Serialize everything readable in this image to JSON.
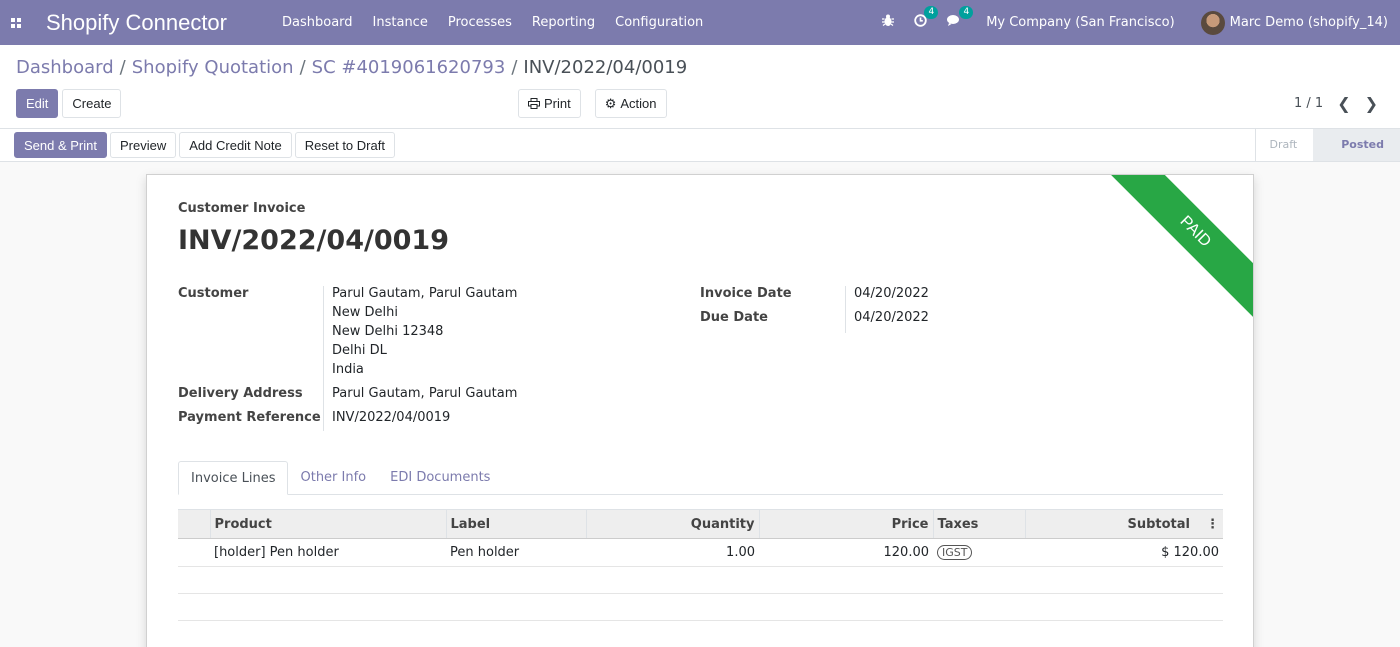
{
  "navbar": {
    "app_name": "Shopify Connector",
    "menu": [
      "Dashboard",
      "Instance",
      "Processes",
      "Reporting",
      "Configuration"
    ],
    "activity_count": "4",
    "message_count": "4",
    "company": "My Company (San Francisco)",
    "user": "Marc Demo (shopify_14)"
  },
  "breadcrumb": {
    "items": [
      "Dashboard",
      "Shopify Quotation",
      "SC #4019061620793"
    ],
    "current": "INV/2022/04/0019"
  },
  "buttons": {
    "edit": "Edit",
    "create": "Create",
    "print": "Print",
    "action": "Action"
  },
  "pager": {
    "value": "1 / 1"
  },
  "statusbar": {
    "buttons": [
      "Send & Print",
      "Preview",
      "Add Credit Note",
      "Reset to Draft"
    ],
    "stages": [
      "Draft",
      "Posted"
    ]
  },
  "invoice": {
    "ribbon": "PAID",
    "type": "Customer Invoice",
    "name": "INV/2022/04/0019",
    "customer_label": "Customer",
    "customer_name": "Parul Gautam, Parul Gautam",
    "address": [
      "New Delhi",
      "New Delhi 12348",
      "Delhi DL",
      "India"
    ],
    "delivery_label": "Delivery Address",
    "delivery_value": "Parul Gautam, Parul Gautam",
    "payment_ref_label": "Payment Reference",
    "payment_ref_value": "INV/2022/04/0019",
    "invoice_date_label": "Invoice Date",
    "invoice_date": "04/20/2022",
    "due_date_label": "Due Date",
    "due_date": "04/20/2022"
  },
  "tabs": [
    "Invoice Lines",
    "Other Info",
    "EDI Documents"
  ],
  "lines_table": {
    "headers": [
      "Product",
      "Label",
      "Quantity",
      "Price",
      "Taxes",
      "Subtotal"
    ],
    "rows": [
      {
        "product": "[holder] Pen holder",
        "label": "Pen holder",
        "quantity": "1.00",
        "price": "120.00",
        "taxes": "IGST",
        "subtotal": "$ 120.00"
      }
    ]
  },
  "icons": {
    "apps": "apps-icon",
    "bug": "bug-icon",
    "activity": "clock-icon",
    "messages": "chat-icon",
    "print": "printer-icon",
    "action": "gear-icon",
    "prev": "chevron-left-icon",
    "next": "chevron-right-icon",
    "optional_columns": "kebab-icon"
  },
  "colors": {
    "brand": "#7c7bad",
    "paid_ribbon": "#28a745",
    "badge": "#00a09d"
  }
}
